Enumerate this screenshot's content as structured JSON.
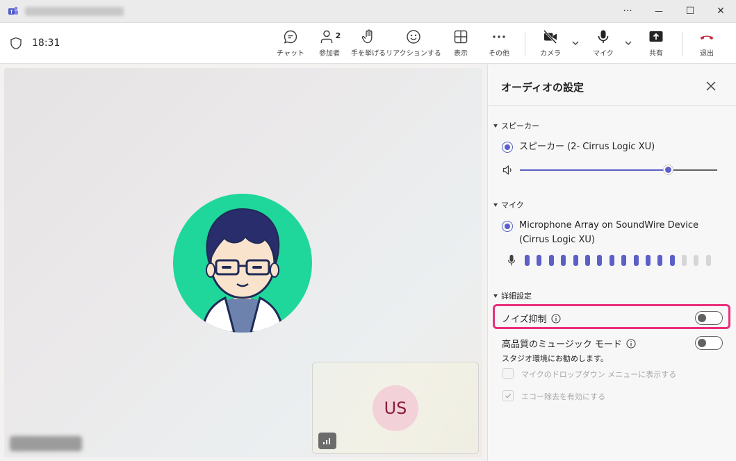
{
  "window": {
    "minimize_glyph": "—",
    "maximize_glyph": "☐",
    "close_glyph": "✕",
    "more_glyph": "···"
  },
  "toolbar": {
    "time": "18:31",
    "chat_label": "チャット",
    "participants_label": "参加者",
    "participants_count": "2",
    "raise_hand_label": "手を挙げる",
    "reactions_label": "リアクションする",
    "view_label": "表示",
    "more_label": "その他",
    "camera_label": "カメラ",
    "mic_label": "マイク",
    "share_label": "共有",
    "leave_label": "退出"
  },
  "stage": {
    "self_initials": "US"
  },
  "panel": {
    "title": "オーディオの設定",
    "speaker_section": "スピーカー",
    "speaker_device": "スピーカー (2- Cirrus Logic XU)",
    "speaker_volume_percent": 75,
    "mic_section": "マイク",
    "mic_device_line1": "Microphone Array on SoundWire Device",
    "mic_device_line2": "(Cirrus Logic XU)",
    "mic_level_active_bars": 13,
    "mic_level_total_bars": 16,
    "advanced_section": "詳細設定",
    "noise_suppression_label": "ノイズ抑制",
    "noise_suppression_on": false,
    "music_mode_label": "高品質のミュージック モード",
    "music_mode_on": false,
    "music_mode_desc": "スタジオ環境にお勧めします。",
    "show_in_mic_dropdown_label": "マイクのドロップダウン メニューに表示する",
    "show_in_mic_dropdown_checked": false,
    "echo_cancel_label": "エコー除去を有効にする",
    "echo_cancel_checked": true
  },
  "colors": {
    "accent": "#5b5fc7",
    "leave": "#c4314b",
    "highlight": "#e8307a",
    "avatar_bg": "#1fd79a",
    "self_avatar_bg": "#f2d1d9"
  }
}
